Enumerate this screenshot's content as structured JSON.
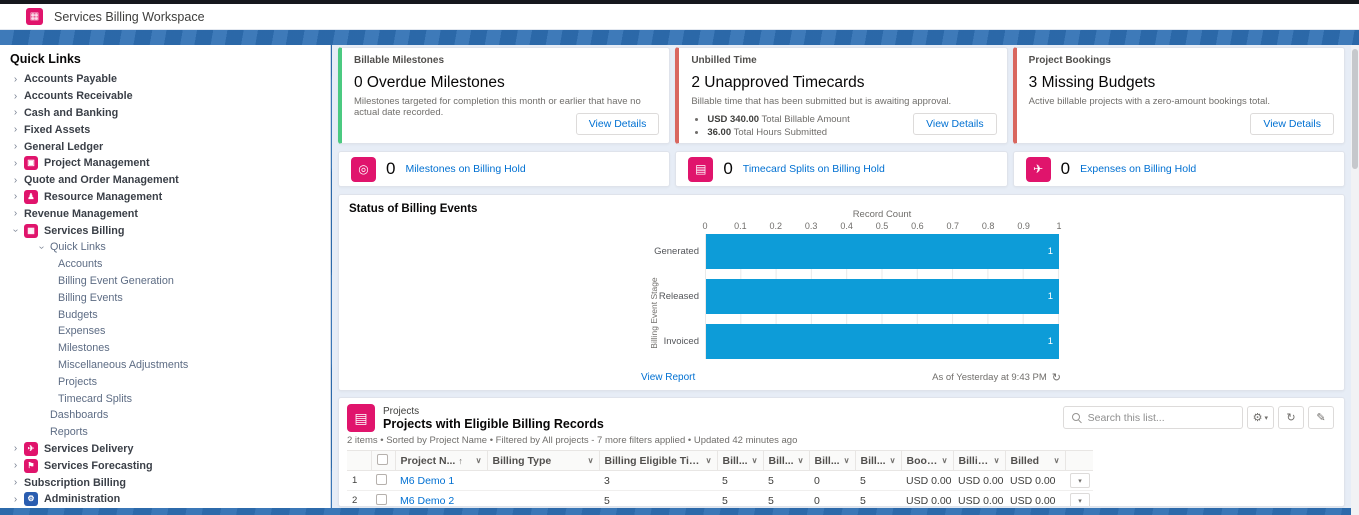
{
  "header": {
    "app_title": "Services Billing Workspace"
  },
  "icons": {
    "chevron": "›",
    "caret_down": "∨",
    "sort_ascending": "↑",
    "gear": "⚙",
    "gear_caret": "▾",
    "refresh": "↻",
    "edit": "✎",
    "row_action_caret": "▾",
    "app_glyph": "▦",
    "projects_glyph": "▤"
  },
  "sidebar": {
    "title": "Quick Links",
    "items": [
      {
        "slug": "accounts-payable",
        "label": "Accounts Payable",
        "level": 0,
        "chevron": "right"
      },
      {
        "slug": "accounts-receivable",
        "label": "Accounts Receivable",
        "level": 0,
        "chevron": "right"
      },
      {
        "slug": "cash-and-banking",
        "label": "Cash and Banking",
        "level": 0,
        "chevron": "right"
      },
      {
        "slug": "fixed-assets",
        "label": "Fixed Assets",
        "level": 0,
        "chevron": "right"
      },
      {
        "slug": "general-ledger",
        "label": "General Ledger",
        "level": 0,
        "chevron": "right"
      },
      {
        "slug": "project-management",
        "label": "Project Management",
        "level": 0,
        "chevron": "right",
        "icon": {
          "name": "project-management-icon",
          "glyph": "▣",
          "color": "#e0146c"
        }
      },
      {
        "slug": "quote-and-order-management",
        "label": "Quote and Order Management",
        "level": 0,
        "chevron": "right"
      },
      {
        "slug": "resource-management",
        "label": "Resource Management",
        "level": 0,
        "chevron": "right",
        "icon": {
          "name": "resource-management-icon",
          "glyph": "♟",
          "color": "#e0146c"
        }
      },
      {
        "slug": "revenue-management",
        "label": "Revenue Management",
        "level": 0,
        "chevron": "right"
      },
      {
        "slug": "services-billing",
        "label": "Services Billing",
        "level": 0,
        "chevron": "down",
        "icon": {
          "name": "services-billing-icon",
          "glyph": "▦",
          "color": "#e0146c"
        }
      },
      {
        "slug": "quick-links-group",
        "label": "Quick Links",
        "level": 1,
        "chevron": "down"
      },
      {
        "slug": "accounts",
        "label": "Accounts",
        "level": 2
      },
      {
        "slug": "billing-event-generation",
        "label": "Billing Event Generation",
        "level": 2
      },
      {
        "slug": "billing-events",
        "label": "Billing Events",
        "level": 2
      },
      {
        "slug": "budgets",
        "label": "Budgets",
        "level": 2
      },
      {
        "slug": "expenses",
        "label": "Expenses",
        "level": 2
      },
      {
        "slug": "milestones",
        "label": "Milestones",
        "level": 2
      },
      {
        "slug": "miscellaneous-adjustments",
        "label": "Miscellaneous Adjustments",
        "level": 2
      },
      {
        "slug": "projects",
        "label": "Projects",
        "level": 2
      },
      {
        "slug": "timecard-splits",
        "label": "Timecard Splits",
        "level": 2
      },
      {
        "slug": "dashboards",
        "label": "Dashboards",
        "level": 3
      },
      {
        "slug": "reports",
        "label": "Reports",
        "level": 3
      },
      {
        "slug": "services-delivery",
        "label": "Services Delivery",
        "level": 0,
        "chevron": "right",
        "icon": {
          "name": "services-delivery-icon",
          "glyph": "✈",
          "color": "#e0146c"
        }
      },
      {
        "slug": "services-forecasting",
        "label": "Services Forecasting",
        "level": 0,
        "chevron": "right",
        "icon": {
          "name": "services-forecasting-icon",
          "glyph": "⚑",
          "color": "#e0146c"
        }
      },
      {
        "slug": "subscription-billing",
        "label": "Subscription Billing",
        "level": 0,
        "chevron": "right"
      },
      {
        "slug": "administration",
        "label": "Administration",
        "level": 0,
        "chevron": "right",
        "icon": {
          "name": "administration-icon",
          "glyph": "⚙",
          "color": "#2a5db0"
        }
      }
    ]
  },
  "cards": [
    {
      "category": "Billable Milestones",
      "title": "0 Overdue Milestones",
      "description": "Milestones targeted for completion this month or earlier that have no actual date recorded.",
      "button": "View Details",
      "accent": "#4bca81"
    },
    {
      "category": "Unbilled Time",
      "title": "2 Unapproved Timecards",
      "description": "Billable time that has been submitted but is awaiting approval.",
      "button": "View Details",
      "accent": "#d9675f",
      "bullets": [
        {
          "value": "USD 340.00",
          "label": " Total Billable Amount"
        },
        {
          "value": "36.00",
          "label": " Total Hours Submitted"
        }
      ]
    },
    {
      "category": "Project Bookings",
      "title": "3 Missing Budgets",
      "description": "Active billable projects with a zero-amount bookings total.",
      "button": "View Details",
      "accent": "#d9675f"
    }
  ],
  "hold_cards": [
    {
      "count": "0",
      "label": "Milestones on Billing Hold",
      "icon_name": "milestones-hold-icon",
      "glyph": "◎"
    },
    {
      "count": "0",
      "label": "Timecard Splits on Billing Hold",
      "icon_name": "timecard-splits-hold-icon",
      "glyph": "▤"
    },
    {
      "count": "0",
      "label": "Expenses on Billing Hold",
      "icon_name": "expenses-hold-icon",
      "glyph": "✈"
    }
  ],
  "chart": {
    "title": "Status of Billing Events",
    "view_report": "View Report",
    "as_of": "As of Yesterday at 9:43 PM"
  },
  "chart_data": {
    "type": "bar",
    "orientation": "horizontal",
    "categories": [
      "Generated",
      "Released",
      "Invoiced"
    ],
    "values": [
      1,
      1,
      1
    ],
    "title": "Status of Billing Events",
    "xlabel": "Record Count",
    "ylabel": "Billing Event Stage",
    "xlim": [
      0,
      1
    ],
    "ticks": [
      "0",
      "0.1",
      "0.2",
      "0.3",
      "0.4",
      "0.5",
      "0.6",
      "0.7",
      "0.8",
      "0.9",
      "1"
    ],
    "bar_color": "#0d9cd8",
    "grid": true,
    "legend": false
  },
  "table": {
    "entity": "Projects",
    "title": "Projects with Eligible Billing Records",
    "meta": "2 items • Sorted by Project Name • Filtered by All projects - 7 more filters applied • Updated 42 minutes ago",
    "search_placeholder": "Search this list...",
    "columns": [
      {
        "label": "Project N...",
        "sorted": true
      },
      {
        "label": "Billing Type"
      },
      {
        "label": "Billing Eligible Timecard..."
      },
      {
        "label": "Bill..."
      },
      {
        "label": "Bill..."
      },
      {
        "label": "Bill..."
      },
      {
        "label": "Bill..."
      },
      {
        "label": "Bookings"
      },
      {
        "label": "Billings"
      },
      {
        "label": "Billed"
      }
    ],
    "rows": [
      {
        "num": "1",
        "name": "M6 Demo 1",
        "billing_type": "",
        "eligible": "3",
        "b1": "5",
        "b2": "5",
        "b3": "0",
        "b4": "5",
        "bookings": "USD 0.00",
        "billings": "USD 0.00",
        "billed": "USD 0.00"
      },
      {
        "num": "2",
        "name": "M6 Demo 2",
        "billing_type": "",
        "eligible": "5",
        "b1": "5",
        "b2": "5",
        "b3": "0",
        "b4": "5",
        "bookings": "USD 0.00",
        "billings": "USD 0.00",
        "billed": "USD 0.00"
      }
    ]
  },
  "colors": {
    "brand_pink": "#e0146c",
    "nav_blue": "#2e6fb3",
    "link_blue": "#0070d2",
    "success_green": "#4bca81",
    "warning_red": "#d9675f",
    "chart_bar_blue": "#0d9cd8"
  }
}
